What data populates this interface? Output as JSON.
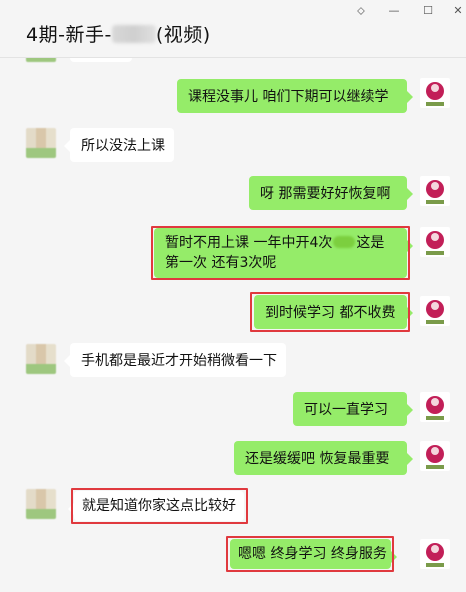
{
  "window": {
    "title_prefix": "4期-新手-",
    "title_suffix": "(视频)",
    "controls": [
      "⬦",
      "—",
      "☐",
      "✕"
    ]
  },
  "messages": [
    {
      "side": "me",
      "text": "课程没事儿  咱们下期可以继续学"
    },
    {
      "side": "other",
      "text": "所以没法上课"
    },
    {
      "side": "me",
      "text": "呀  那需要好好恢复啊"
    },
    {
      "side": "me",
      "line1_a": "暂时不用上课  一年中开4次",
      "line1_b": "这是",
      "line2": "第一次  还有3次呢",
      "highlighted": true
    },
    {
      "side": "me",
      "text": "到时候学习  都不收费",
      "highlighted": true
    },
    {
      "side": "other",
      "text": "手机都是最近才开始稍微看一下"
    },
    {
      "side": "me",
      "text": "可以一直学习"
    },
    {
      "side": "me",
      "text": "还是缓缓吧  恢复最重要"
    },
    {
      "side": "other",
      "text": "就是知道你家这点比较好",
      "highlighted": true
    },
    {
      "side": "me",
      "text": "嗯嗯  终身学习  终身服务",
      "highlighted": true
    }
  ],
  "colors": {
    "my_bubble": "#95ec69",
    "other_bubble": "#ffffff",
    "highlight": "#e0393e",
    "background": "#f5f5f5"
  }
}
